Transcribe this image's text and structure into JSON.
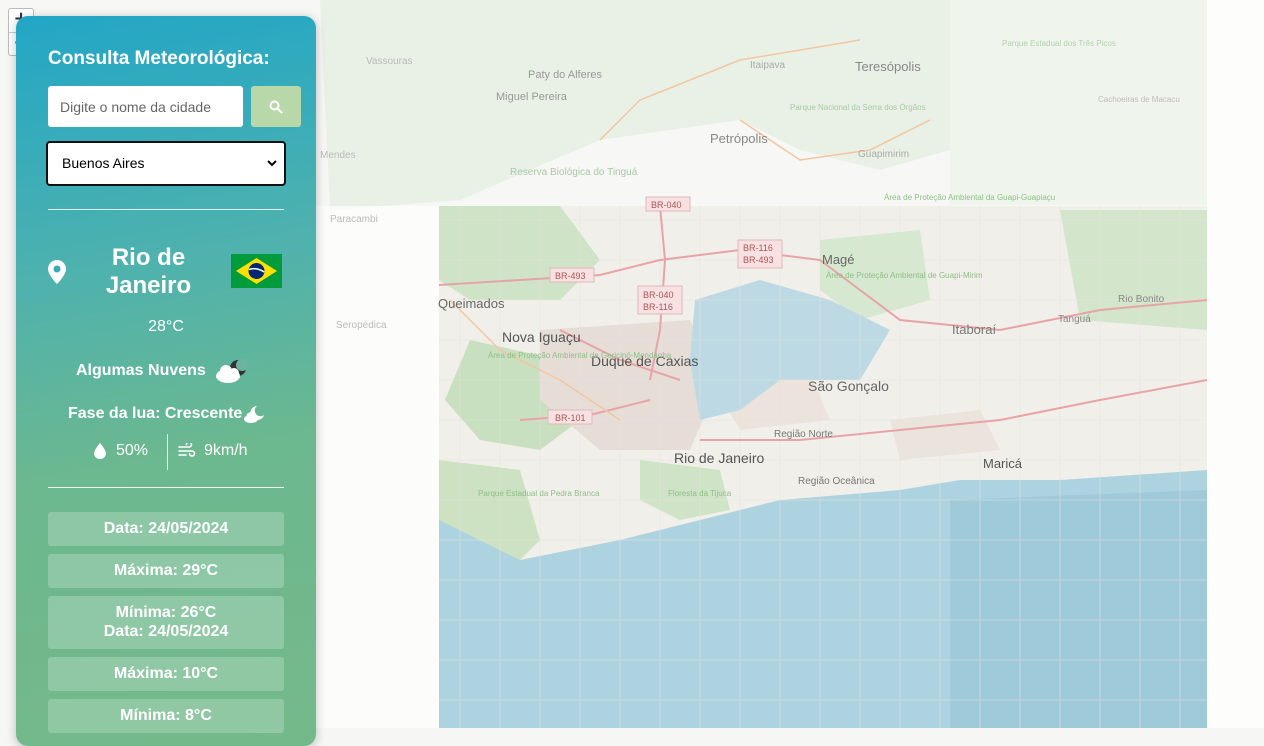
{
  "map": {
    "labels": [
      {
        "text": "Vassouras"
      },
      {
        "text": "Paty do Alferes"
      },
      {
        "text": "Miguel Pereira"
      },
      {
        "text": "Itaipava"
      },
      {
        "text": "Teresópolis"
      },
      {
        "text": "Petrópolis"
      },
      {
        "text": "Parque Nacional da Serra dos Órgãos"
      },
      {
        "text": "Guapimirim"
      },
      {
        "text": "Mendes"
      },
      {
        "text": "Reserva Biológica do Tinguá"
      },
      {
        "text": "Paracambi"
      },
      {
        "text": "Queimados"
      },
      {
        "text": "Nova Iguaçu"
      },
      {
        "text": "Duque de Caxias"
      },
      {
        "text": "Magé"
      },
      {
        "text": "São Gonçalo"
      },
      {
        "text": "Itaboraí"
      },
      {
        "text": "Tanguá"
      },
      {
        "text": "Rio Bonito"
      },
      {
        "text": "Rio de Janeiro"
      },
      {
        "text": "Região Norte"
      },
      {
        "text": "Região Oceânica"
      },
      {
        "text": "Maricá"
      },
      {
        "text": "Seropédica"
      },
      {
        "text": "Área de Proteção Ambiental de Gericinó-Mendanha"
      },
      {
        "text": "Área de Proteção Ambiental de Guapi-Mirim"
      },
      {
        "text": "Área de Proteção Ambiental da Guapi-Guapiaçu"
      },
      {
        "text": "Parque Estadual dos Três Picos"
      },
      {
        "text": "Cachoeiras de Macacu"
      },
      {
        "text": "Parque Estadual da Pedra Branca"
      },
      {
        "text": "Floresta da Tijuca"
      }
    ],
    "shields": [
      "BR-040",
      "BR-116",
      "BR-493",
      "BR-493",
      "BR-040",
      "BR-116",
      "BR-101"
    ],
    "zoom_in": "+",
    "zoom_out": "−"
  },
  "panel": {
    "title": "Consulta Meteorológica:",
    "search_placeholder": "Digite o nome da cidade",
    "selected_city": "Buenos Aires",
    "city_line1": "Rio de",
    "city_line2": "Janeiro",
    "temperature": "28°C",
    "description": "Algumas Nuvens",
    "moon": "Fase da lua: Crescente",
    "humidity": "50%",
    "wind": "9km/h",
    "forecast": [
      {
        "data": "Data: 24/05/2024",
        "max": "Máxima: 29°C",
        "min": "Mínima: 26°C"
      },
      {
        "data": "Data: 24/05/2024",
        "max": "Máxima: 10°C",
        "min": "Mínima: 8°C"
      }
    ]
  },
  "colors": {
    "accent_start": "#22a6c6",
    "accent_end": "#74b98a",
    "search_button": "#b9d8a9"
  }
}
